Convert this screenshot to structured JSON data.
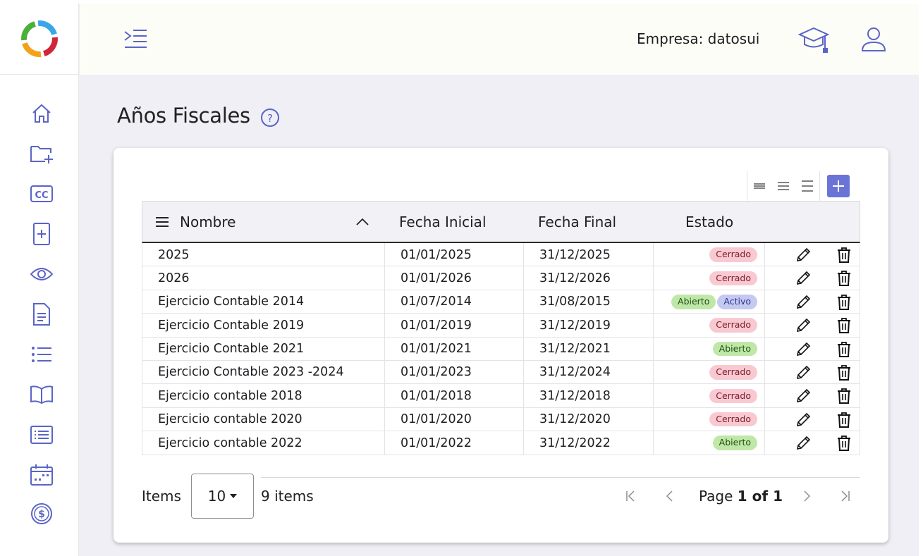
{
  "header": {
    "company_label": "Empresa: datosui"
  },
  "page": {
    "title": "Años Fiscales"
  },
  "sidebar": {
    "items": [
      {
        "icon": "home-icon"
      },
      {
        "icon": "folder-add-icon"
      },
      {
        "icon": "cc-icon"
      },
      {
        "icon": "document-add-icon"
      },
      {
        "icon": "eye-icon"
      },
      {
        "icon": "document-icon"
      },
      {
        "icon": "list-icon"
      },
      {
        "icon": "book-icon"
      },
      {
        "icon": "list-box-icon"
      },
      {
        "icon": "calendar-icon"
      },
      {
        "icon": "dollar-icon"
      }
    ]
  },
  "table": {
    "columns": {
      "nombre": "Nombre",
      "fecha_inicial": "Fecha Inicial",
      "fecha_final": "Fecha Final",
      "estado": "Estado"
    },
    "rows": [
      {
        "nombre": "2025",
        "fecha_inicial": "01/01/2025",
        "fecha_final": "31/12/2025",
        "estado": [
          "Cerrado"
        ]
      },
      {
        "nombre": "2026",
        "fecha_inicial": "01/01/2026",
        "fecha_final": "31/12/2026",
        "estado": [
          "Cerrado"
        ]
      },
      {
        "nombre": "Ejercicio Contable 2014",
        "fecha_inicial": "01/07/2014",
        "fecha_final": "31/08/2015",
        "estado": [
          "Abierto",
          "Activo"
        ]
      },
      {
        "nombre": "Ejercicio Contable 2019",
        "fecha_inicial": "01/01/2019",
        "fecha_final": "31/12/2019",
        "estado": [
          "Cerrado"
        ]
      },
      {
        "nombre": "Ejercicio Contable 2021",
        "fecha_inicial": "01/01/2021",
        "fecha_final": "31/12/2021",
        "estado": [
          "Abierto"
        ]
      },
      {
        "nombre": "Ejercicio Contable 2023 -2024",
        "fecha_inicial": "01/01/2023",
        "fecha_final": "31/12/2024",
        "estado": [
          "Cerrado"
        ]
      },
      {
        "nombre": "Ejercicio contable 2018",
        "fecha_inicial": "01/01/2018",
        "fecha_final": "31/12/2018",
        "estado": [
          "Cerrado"
        ]
      },
      {
        "nombre": "Ejercicio contable 2020",
        "fecha_inicial": "01/01/2020",
        "fecha_final": "31/12/2020",
        "estado": [
          "Cerrado"
        ]
      },
      {
        "nombre": "Ejercicio contable 2022",
        "fecha_inicial": "01/01/2022",
        "fecha_final": "31/12/2022",
        "estado": [
          "Abierto"
        ]
      }
    ]
  },
  "pager": {
    "items_label": "Items",
    "page_size": "10",
    "items_count": "9 items",
    "page_prefix": "Page ",
    "page_current": "1",
    "page_of": " of ",
    "page_total": "1"
  },
  "colors": {
    "accent": "#5a64c8",
    "add_button": "#6a74d6",
    "cerrado_bg": "#f9c9d1",
    "abierto_bg": "#bfe8a8",
    "activo_bg": "#c4c9f0"
  }
}
